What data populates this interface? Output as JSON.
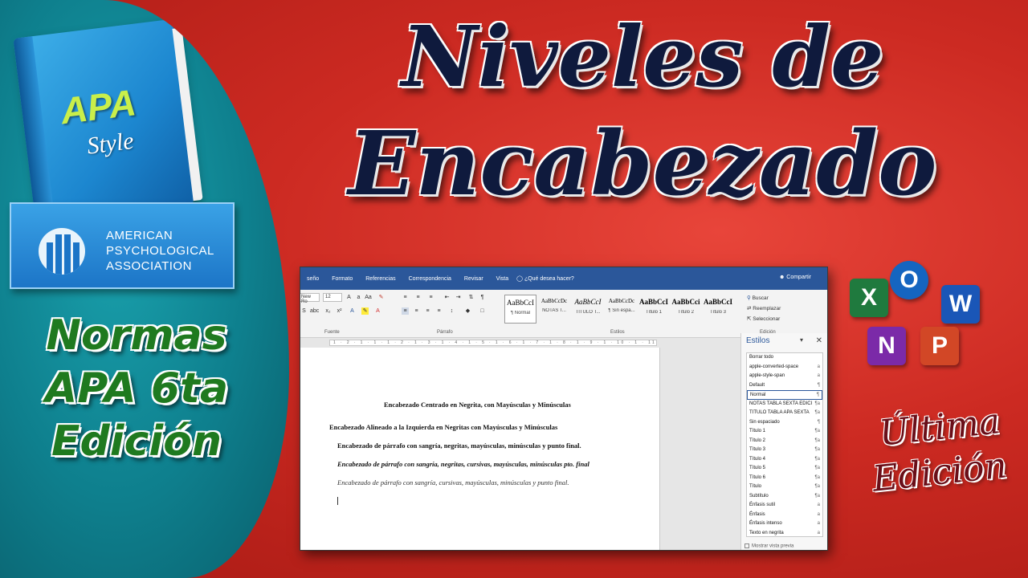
{
  "title": {
    "line1": "Niveles de",
    "line2": "Encabezado"
  },
  "book": {
    "apa": "APA",
    "style": "Style"
  },
  "assoc": {
    "line1": "AMERICAN",
    "line2": "PSYCHOLOGICAL",
    "line3": "ASSOCIATION"
  },
  "normas": {
    "line1": "Normas",
    "line2": "APA 6ta",
    "line3": "Edición"
  },
  "ultima": {
    "line1": "Última",
    "line2": "Edición"
  },
  "office_icons": [
    {
      "letter": "X",
      "color": "#1f7a3e"
    },
    {
      "letter": "O",
      "color": "#1565c0"
    },
    {
      "letter": "W",
      "color": "#1a56b7"
    },
    {
      "letter": "N",
      "color": "#7b2aa8"
    },
    {
      "letter": "P",
      "color": "#d24726"
    }
  ],
  "colors": {
    "word_blue": "#2b579a",
    "background_red": "#cc2a22",
    "panel_teal": "#0e7f8d"
  },
  "word": {
    "tabs": [
      "seño",
      "Formato",
      "Referencias",
      "Correspondencia",
      "Revisar",
      "Vista"
    ],
    "tell_me": "¿Qué desea hacer?",
    "share": "Compartir",
    "font_name": "New Ro",
    "font_size": "12",
    "group_labels": {
      "font": "Fuente",
      "paragraph": "Párrafo",
      "styles": "Estilos",
      "editing": "Edición"
    },
    "style_gallery": [
      {
        "sample": "AaBbCcI",
        "name": "¶ Normal"
      },
      {
        "sample": "AaBbCcDc",
        "name": "NOTAS T..."
      },
      {
        "sample": "AaBbCcI",
        "name": "TITULO T..."
      },
      {
        "sample": "AaBbCcDc",
        "name": "¶ Sin espa..."
      },
      {
        "sample": "AaBbCcI",
        "name": "Título 1"
      },
      {
        "sample": "AaBbCci",
        "name": "Título 2"
      },
      {
        "sample": "AaBbCcI",
        "name": "Título 3"
      }
    ],
    "editing": {
      "find": "Buscar",
      "replace": "Reemplazar",
      "select": "Seleccionar"
    },
    "ruler": "1 · 2 · 1 · 1 · 1 · 2 · 1 · 3 · 1 · 4 · 1 · 5 · 1 · 6 · 1 · 7 · 1 · 8 · 1 · 9 · 1 · 10 · 1 · 11 · 1 · 12 · 1 · 13 · 1 · 14 · 1 · 15 · 1 · 16 · 1 · 17 · 1 · 18 · 1 · 19",
    "document_lines": [
      "Encabezado Centrado en Negrita, con Mayúsculas y Minúsculas",
      "Encabezado Alineado a la Izquierda en Negritas con Mayúsculas y Minúsculas",
      "Encabezado de párrafo con sangría, negritas, mayúsculas, minúsculas y punto final.",
      "Encabezado de párrafo con sangría, negritas, cursivas, mayúsculas, minúsculas pto. final",
      "Encabezado de párrafo con sangría, cursivas, mayúsculas, minúsculas y punto final."
    ],
    "styles_pane": {
      "title": "Estilos",
      "items": [
        {
          "name": "Borrar todo",
          "mark": ""
        },
        {
          "name": "apple-converted-space",
          "mark": "a"
        },
        {
          "name": "apple-style-span",
          "mark": "a"
        },
        {
          "name": "Default",
          "mark": "¶"
        },
        {
          "name": "Normal",
          "mark": "¶"
        },
        {
          "name": "NOTAS TABLA SEXTA EDICI",
          "mark": "¶a"
        },
        {
          "name": "TITULO TABLA APA SEXTA",
          "mark": "¶a"
        },
        {
          "name": "Sin espaciado",
          "mark": "¶"
        },
        {
          "name": "Título 1",
          "mark": "¶a"
        },
        {
          "name": "Título 2",
          "mark": "¶a"
        },
        {
          "name": "Título 3",
          "mark": "¶a"
        },
        {
          "name": "Título 4",
          "mark": "¶a"
        },
        {
          "name": "Título 5",
          "mark": "¶a"
        },
        {
          "name": "Título 6",
          "mark": "¶a"
        },
        {
          "name": "Título",
          "mark": "¶a"
        },
        {
          "name": "Subtítulo",
          "mark": "¶a"
        },
        {
          "name": "Énfasis sutil",
          "mark": "a"
        },
        {
          "name": "Énfasis",
          "mark": "a"
        },
        {
          "name": "Énfasis intenso",
          "mark": "a"
        },
        {
          "name": "Texto en negrita",
          "mark": "a"
        }
      ],
      "preview_label": "Mostrar vista previa"
    }
  }
}
